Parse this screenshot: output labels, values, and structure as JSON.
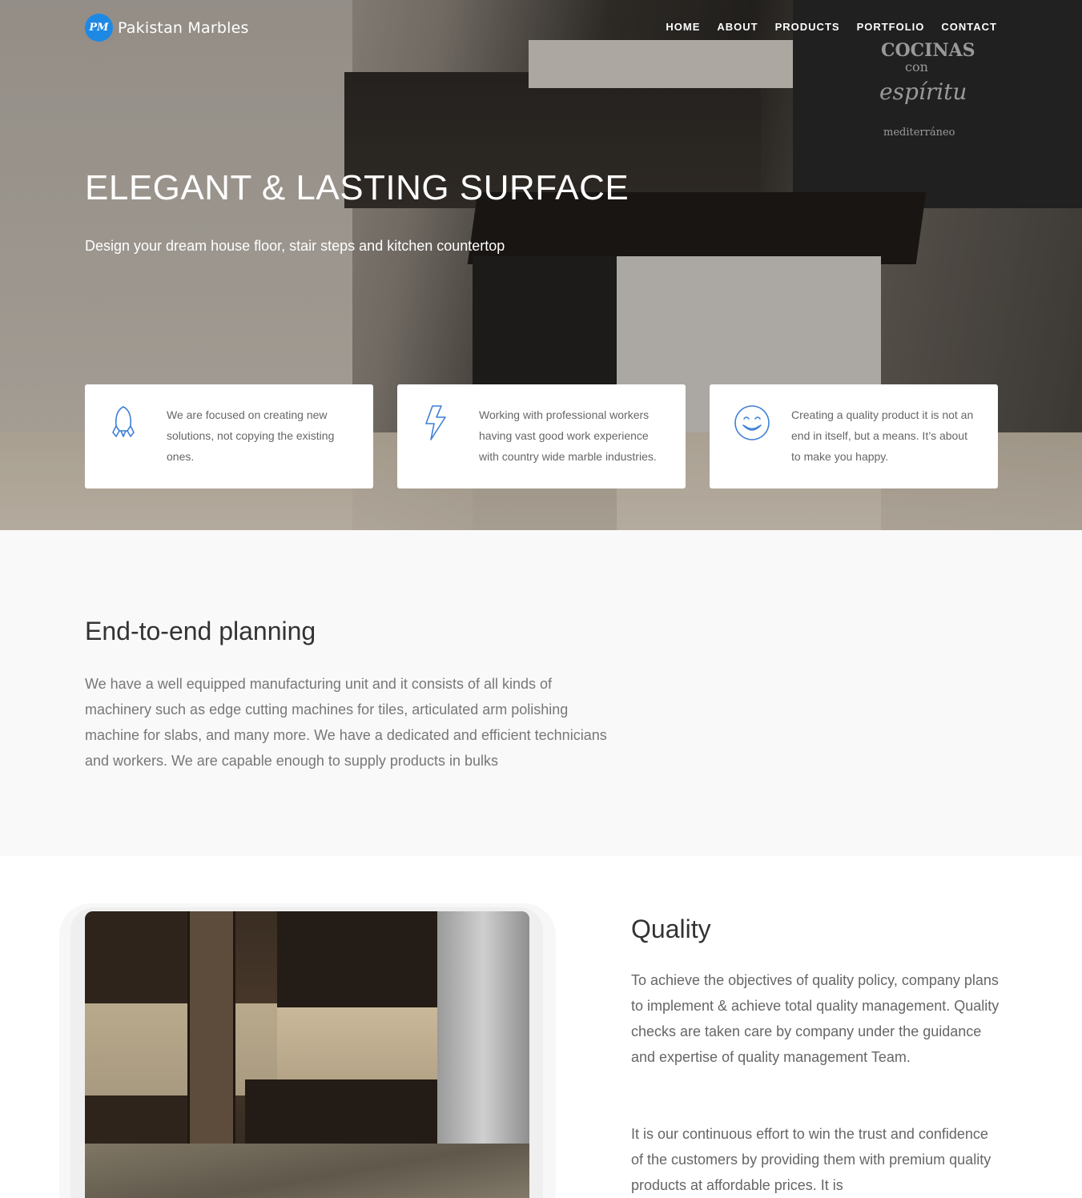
{
  "brand": {
    "logo_mark": "PM",
    "name": "Pakistan Marbles",
    "accent": "#1e88e5"
  },
  "nav": {
    "items": [
      "HOME",
      "ABOUT",
      "PRODUCTS",
      "PORTFOLIO",
      "CONTACT"
    ]
  },
  "hero": {
    "title": "ELEGANT & LASTING SURFACE",
    "subtitle": "Design your dream house floor, stair steps and kitchen countertop",
    "chalkboard": [
      "COCINAS",
      "con",
      "espíritu",
      "mediterráneo"
    ]
  },
  "features": [
    {
      "icon": "rocket-icon",
      "text": "We are focused on creating new solutions, not copying the existing ones."
    },
    {
      "icon": "lightning-icon",
      "text": "Working with professional workers having vast good work experience with country wide marble industries."
    },
    {
      "icon": "smiley-icon",
      "text": "Creating a quality product it is not an end in itself, but a means. It’s about to make you happy."
    }
  ],
  "planning": {
    "title": "End-to-end planning",
    "body": "We have a well equipped manufacturing unit and it consists of all kinds of machinery such as edge cutting machines for tiles, articulated arm polishing machine for slabs, and many more. We have a dedicated and efficient technicians and workers. We are capable enough to supply products in bulks"
  },
  "quality": {
    "title": "Quality",
    "paragraph_1": "To achieve the objectives of quality policy, company plans to implement & achieve total quality management. Quality checks are taken care by company under the guidance and expertise of quality management Team.",
    "paragraph_2": "It is our continuous effort to win the trust and confidence of the customers by providing them with premium quality products at affordable prices. It is"
  },
  "colors": {
    "icon_blue": "#3f7fd6",
    "section_bg": "#f9f9f9"
  }
}
